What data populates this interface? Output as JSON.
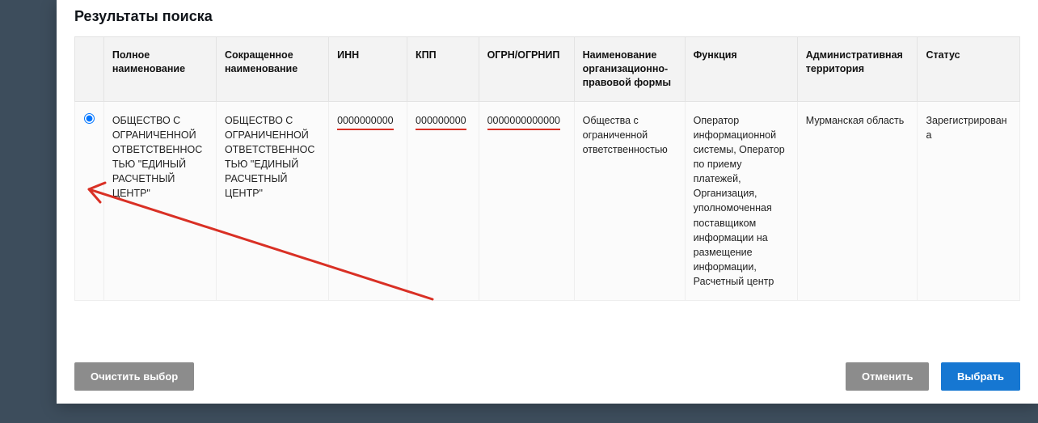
{
  "header": {
    "title": "Результаты поиска"
  },
  "table": {
    "columns": {
      "full_name": "Полное наименование",
      "short_name": "Сокращенное наименование",
      "inn": "ИНН",
      "kpp": "КПП",
      "ogrn": "ОГРН/ОГРНИП",
      "legal_form": "Наименование организационно-правовой формы",
      "function": "Функция",
      "territory": "Административная территория",
      "status": "Статус"
    },
    "rows": [
      {
        "full_name": "ОБЩЕСТВО С ОГРАНИЧЕННОЙ ОТВЕТСТВЕННОСТЬЮ \"ЕДИНЫЙ РАСЧЕТНЫЙ ЦЕНТР\"",
        "short_name": "ОБЩЕСТВО С ОГРАНИЧЕННОЙ ОТВЕТСТВЕННОСТЬЮ \"ЕДИНЫЙ РАСЧЕТНЫЙ ЦЕНТР\"",
        "inn": "0000000000",
        "kpp": "000000000",
        "ogrn": "0000000000000",
        "legal_form": "Общества с ограниченной ответственностью",
        "function": "Оператор информационной системы, Оператор по приему платежей, Организация, уполномоченная поставщиком информации на размещение информации, Расчетный центр",
        "territory": "Мурманская область",
        "status": "Зарегистрирована",
        "selected": true
      }
    ]
  },
  "footer": {
    "clear_button": "Очистить выбор",
    "cancel_button": "Отменить",
    "select_button": "Выбрать"
  },
  "colors": {
    "page_bg": "#3d4d5c",
    "modal_bg": "#ffffff",
    "header_text": "#11151a",
    "table_header_bg": "#f3f3f3",
    "btn_grey": "#8c8c8c",
    "btn_blue": "#1677d2",
    "annotation_red": "#d93025"
  }
}
